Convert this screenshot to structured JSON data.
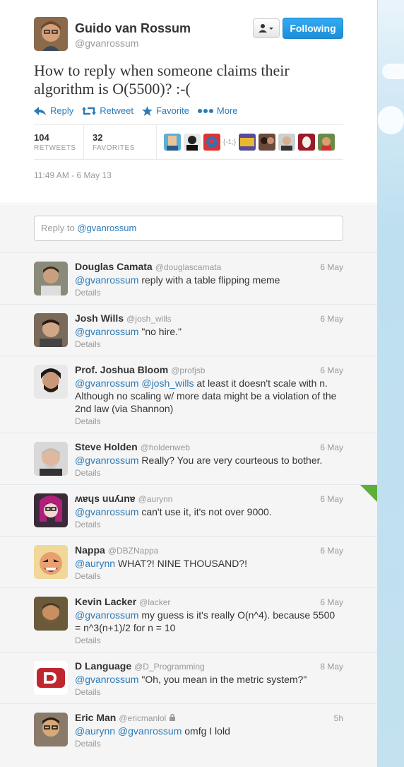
{
  "author": {
    "fullname": "Guido van Rossum",
    "screenname": "@gvanrossum",
    "follow_label": "Following"
  },
  "tweet": {
    "text": "How to reply when someone claims their algorithm is O(5500)? :-(",
    "actions": [
      "Reply",
      "Retweet",
      "Favorite",
      "More"
    ],
    "retweets": "104",
    "retweets_label": "RETWEETS",
    "favorites": "32",
    "favorites_label": "FAVORITES",
    "fav_text": "{-1;}",
    "timestamp": "11:49 AM - 6 May 13"
  },
  "reply_box": {
    "prefix": "Reply to ",
    "mention": "@gvanrossum"
  },
  "replies": [
    {
      "name": "Douglas Camata",
      "sn": "@douglascamata",
      "time": "6 May",
      "mentions": "@gvanrossum",
      "text": " reply with a table flipping meme",
      "details": "Details"
    },
    {
      "name": "Josh Wills",
      "sn": "@josh_wills",
      "time": "6 May",
      "mentions": "@gvanrossum",
      "text": " \"no hire.\"",
      "details": "Details"
    },
    {
      "name": "Prof. Joshua Bloom",
      "sn": "@profjsb",
      "time": "6 May",
      "mentions": "@gvanrossum @josh_wills",
      "text": " at least it doesn't scale with n. Although no scaling w/ more data might be a violation of the 2nd law (via Shannon)",
      "details": "Details"
    },
    {
      "name": "Steve Holden",
      "sn": "@holdenweb",
      "time": "6 May",
      "mentions": "@gvanrossum",
      "text": " Really? You are very courteous to bother.",
      "details": "Details"
    },
    {
      "name": "ʍɐɥs uuʎɹnɐ",
      "sn": "@aurynn",
      "time": "6 May",
      "mentions": "@gvanrossum",
      "text": " can't use it, it's not over 9000.",
      "details": "Details"
    },
    {
      "name": "Nappa",
      "sn": "@DBZNappa",
      "time": "6 May",
      "mentions": "@aurynn",
      "text": " WHAT?! NINE THOUSAND?!",
      "details": "Details"
    },
    {
      "name": "Kevin Lacker",
      "sn": "@lacker",
      "time": "6 May",
      "mentions": "@gvanrossum",
      "text": " my guess is it's really O(n^4). because 5500 = n^3(n+1)/2 for n = 10",
      "details": "Details"
    },
    {
      "name": "D Language",
      "sn": "@D_Programming",
      "time": "8 May",
      "mentions": "@gvanrossum",
      "text": " \"Oh, you mean in the metric system?\"",
      "details": "Details"
    },
    {
      "name": "Eric Man",
      "sn": "@ericmanlol",
      "time": "5h",
      "mentions": "@aurynn @gvanrossum",
      "text": " omfg I lold",
      "details": "Details"
    }
  ],
  "colors": {
    "link": "#2b7bb9",
    "follow": "#1b8fd8",
    "flag": "#5eae3a"
  }
}
